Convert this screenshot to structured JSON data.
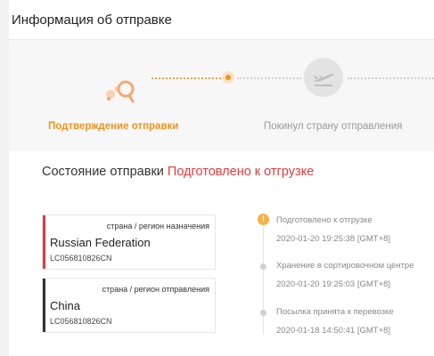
{
  "header": {
    "title": "Информация об отправке"
  },
  "steps": [
    {
      "label": "Подтверждение отправки",
      "icon": "package-icon",
      "state": "active"
    },
    {
      "label": "Покинул страну отправления",
      "icon": "plane-departure-icon",
      "state": "inactive"
    }
  ],
  "status": {
    "label": "Состояние отправки",
    "value": "Подготовлено к отгрузке"
  },
  "cards": [
    {
      "caption": "страна / регион назначения",
      "country": "Russian Federation",
      "tracking": "LC056810826CN",
      "accent": "#e4393c"
    },
    {
      "caption": "страна / регион отправления",
      "country": "China",
      "tracking": "LC056810826CN",
      "accent": "#333333"
    }
  ],
  "timeline": [
    {
      "title": "Подготовлено к отгрузке",
      "date": "2020-01-20 19:25:38 [GMT+8]",
      "marker": "!"
    },
    {
      "title": "Хранение в сортировочном центре",
      "date": "2020-01-20 19:25:03 [GMT+8]"
    },
    {
      "title": "Посылка принята к перевозке",
      "date": "2020-01-18 14:50:41 [GMT+8]"
    }
  ],
  "colors": {
    "accent": "#f0931e",
    "status_red": "#e4393c",
    "muted": "#999999"
  }
}
